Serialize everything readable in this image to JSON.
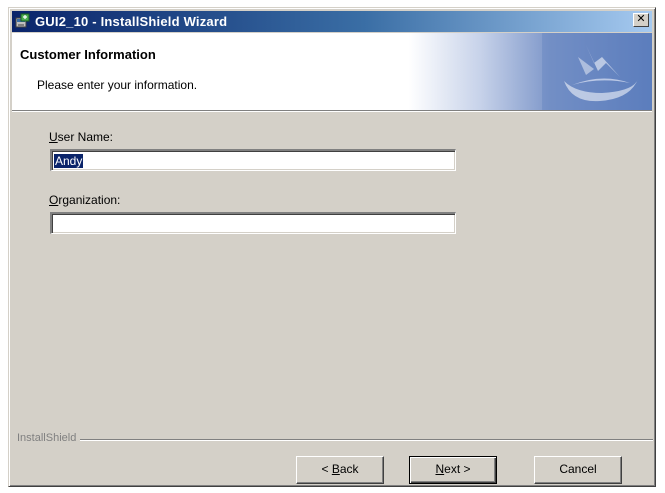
{
  "window": {
    "title": "GUI2_10 - InstallShield Wizard",
    "close_symbol": "✕"
  },
  "banner": {
    "title": "Customer Information",
    "subtitle": "Please enter your information."
  },
  "form": {
    "user_name": {
      "label_access_key": "U",
      "label_rest": "ser Name:",
      "value": "Andy"
    },
    "organization": {
      "label_access_key": "O",
      "label_rest": "rganization:",
      "value": ""
    }
  },
  "footer": {
    "brand": "InstallShield"
  },
  "buttons": {
    "back": {
      "prefix": "< ",
      "access_key": "B",
      "rest": "ack"
    },
    "next": {
      "access_key": "N",
      "rest": "ext >"
    },
    "cancel": {
      "label": "Cancel"
    }
  },
  "icons": {
    "app": "installer-icon",
    "close": "close-icon",
    "logo": "installshield-logo-icon"
  },
  "colors": {
    "titlebar_start": "#0a246a",
    "titlebar_end": "#a6caf0",
    "dialog_face": "#d4d0c8",
    "selection": "#0a246a"
  }
}
